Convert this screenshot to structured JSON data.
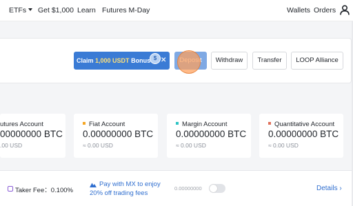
{
  "nav": {
    "etfs": "ETFs",
    "get_bonus": "Get $1,000",
    "learn": "Learn",
    "futures_mday": "Futures M-Day",
    "wallets": "Wallets",
    "orders": "Orders",
    "user_icon": "user-icon"
  },
  "actions": {
    "claim_prefix": "Claim",
    "claim_amount": "1,000 USDT",
    "claim_suffix": "Bonus",
    "deposit": "Deposit",
    "withdraw": "Withdraw",
    "transfer": "Transfer",
    "loop": "LOOP Alliance",
    "close_icon": "close-icon"
  },
  "accounts": [
    {
      "title": "utures Account",
      "btc": "00000000 BTC",
      "usd": ".00 USD",
      "color": ""
    },
    {
      "title": "Fiat Account",
      "btc": "0.00000000 BTC",
      "usd": "≈ 0.00 USD",
      "color": "#f5a623"
    },
    {
      "title": "Margin Account",
      "btc": "0.00000000 BTC",
      "usd": "≈ 0.00 USD",
      "color": "#2ec4c4"
    },
    {
      "title": "Quantitative Account",
      "btc": "0.00000000 BTC",
      "usd": "≈ 0.00 USD",
      "color": "#e0705a"
    }
  ],
  "fees": {
    "taker_label": "Taker Fee：0.100%",
    "mx_text": "Pay with MX to enjoy 20% off trading fees",
    "mx_balance": "0.00000000",
    "mx_toggle_on": false,
    "details": "Details"
  },
  "colors": {
    "accent": "#3a7bd5",
    "link": "#2f6ecf",
    "bonus_highlight": "#ffe17a"
  }
}
